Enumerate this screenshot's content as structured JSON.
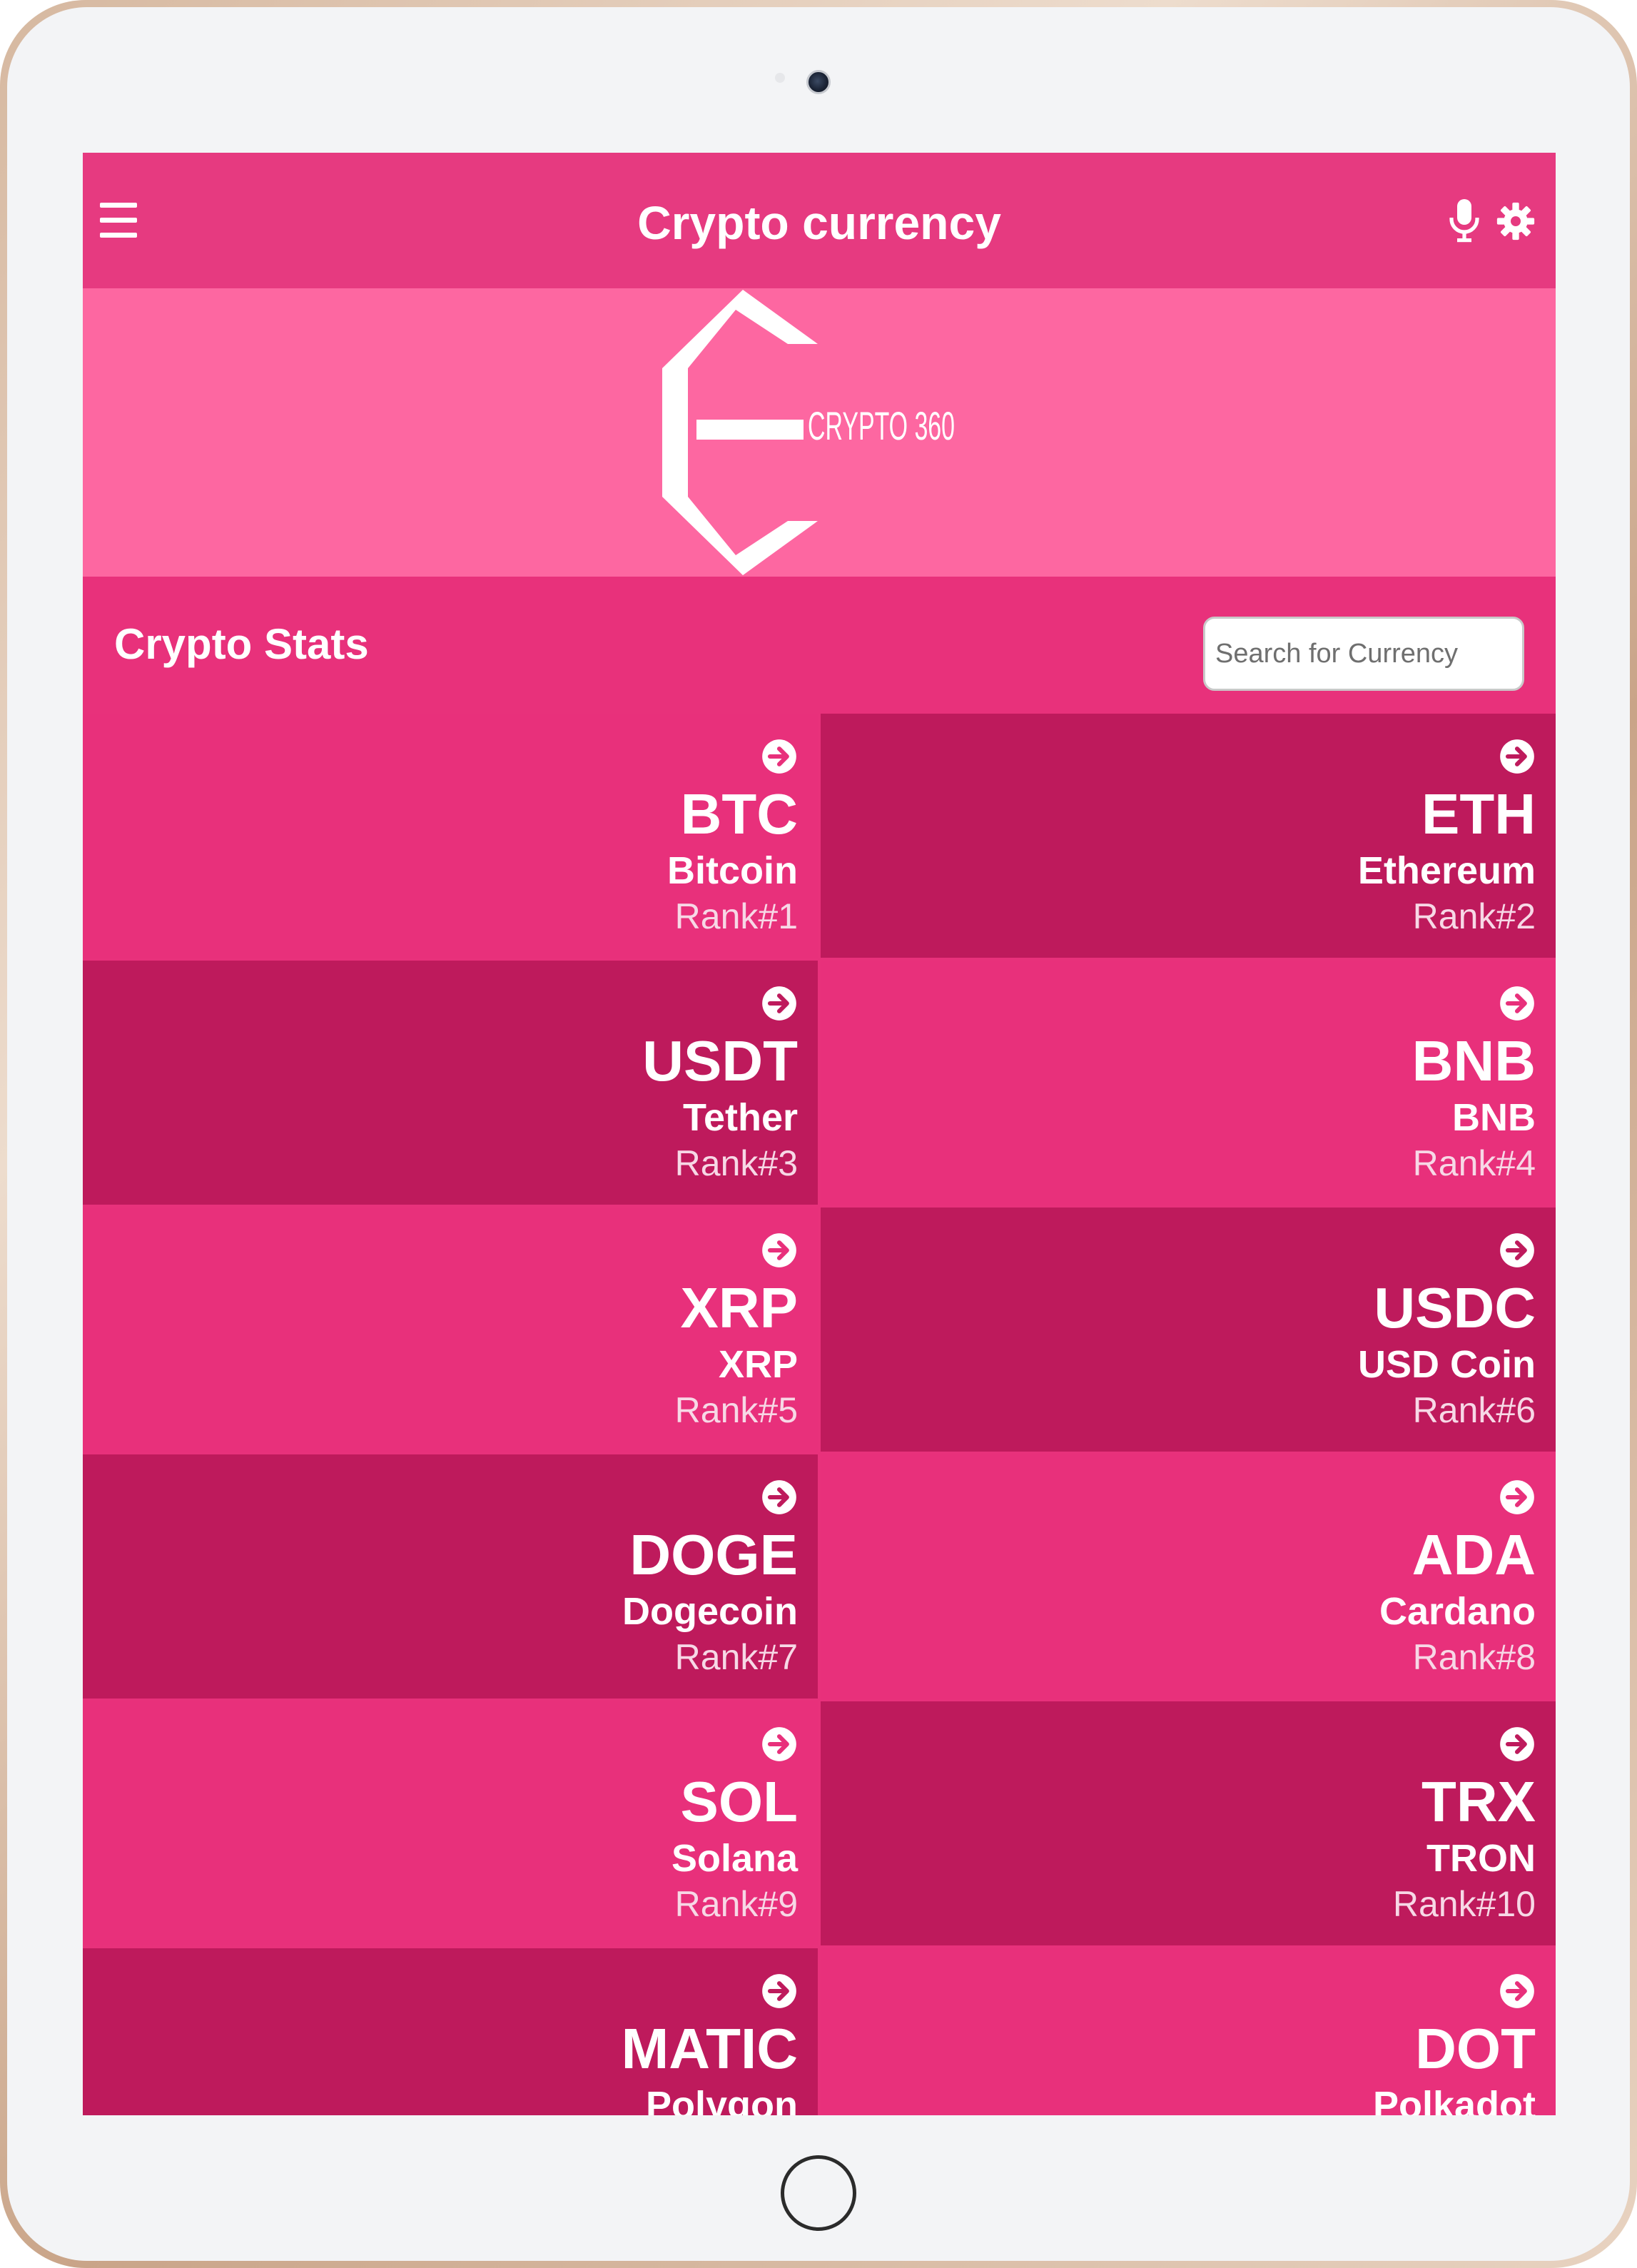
{
  "app_bar": {
    "title": "Crypto currency",
    "menu_icon": "hamburger-menu-icon",
    "mic_icon": "microphone-icon",
    "settings_icon": "gear-icon"
  },
  "banner": {
    "logo_text": "CRYPTO 360"
  },
  "stats": {
    "title": "Crypto Stats",
    "search_placeholder": "Search for Currency"
  },
  "colors": {
    "app_bar": "#e63a80",
    "banner": "#fd67a1",
    "tile_light": "#e8307b",
    "tile_dark": "#be1a5c"
  },
  "coins": [
    {
      "symbol": "BTC",
      "name": "Bitcoin",
      "rank": "Rank#1"
    },
    {
      "symbol": "ETH",
      "name": "Ethereum",
      "rank": "Rank#2"
    },
    {
      "symbol": "USDT",
      "name": "Tether",
      "rank": "Rank#3"
    },
    {
      "symbol": "BNB",
      "name": "BNB",
      "rank": "Rank#4"
    },
    {
      "symbol": "XRP",
      "name": "XRP",
      "rank": "Rank#5"
    },
    {
      "symbol": "USDC",
      "name": "USD Coin",
      "rank": "Rank#6"
    },
    {
      "symbol": "DOGE",
      "name": "Dogecoin",
      "rank": "Rank#7"
    },
    {
      "symbol": "ADA",
      "name": "Cardano",
      "rank": "Rank#8"
    },
    {
      "symbol": "SOL",
      "name": "Solana",
      "rank": "Rank#9"
    },
    {
      "symbol": "TRX",
      "name": "TRON",
      "rank": "Rank#10"
    },
    {
      "symbol": "MATIC",
      "name": "Polygon",
      "rank": ""
    },
    {
      "symbol": "DOT",
      "name": "Polkadot",
      "rank": ""
    }
  ]
}
